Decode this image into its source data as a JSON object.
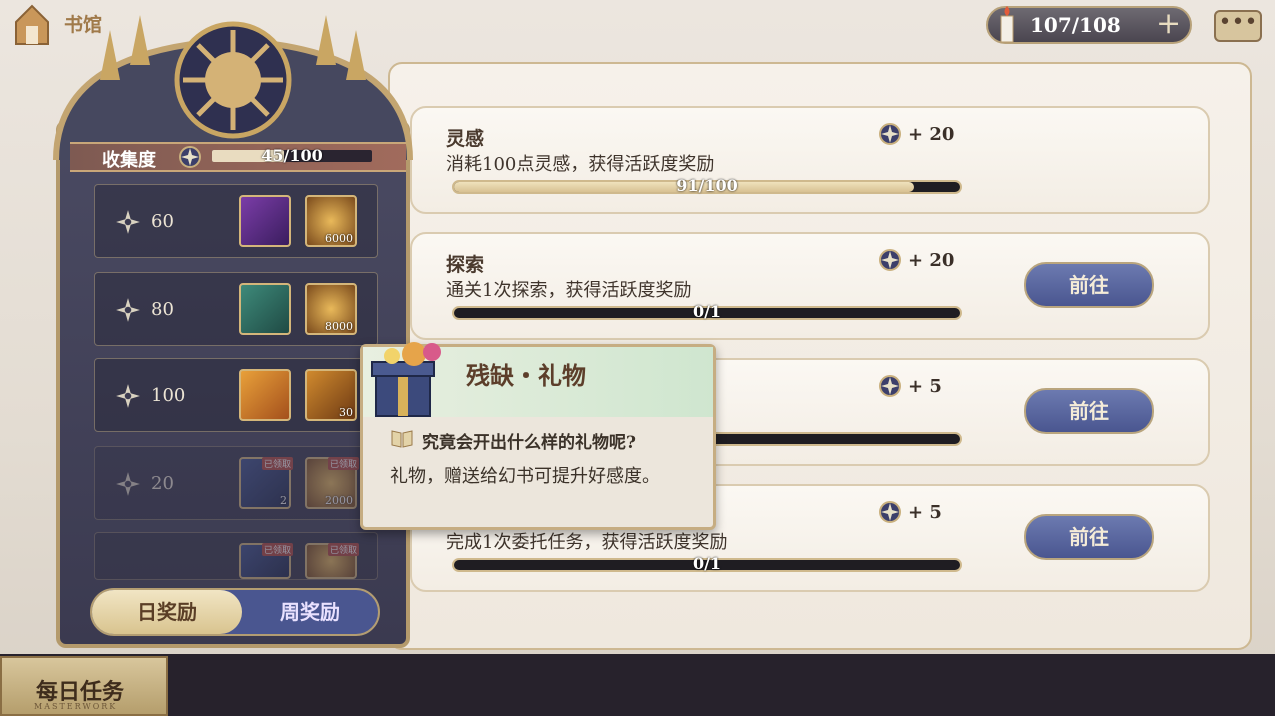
{
  "header": {
    "home_label": "书馆",
    "energy": "107/108",
    "energy_plus": "+",
    "chat_icon": "•••"
  },
  "collection": {
    "label": "收集度",
    "value": "45/100",
    "progress": 0.45
  },
  "rewards": [
    {
      "points": "60",
      "items": [
        {
          "icon": "dice-icon",
          "count": ""
        },
        {
          "icon": "gold-coin-icon",
          "count": "6000"
        }
      ],
      "claimed": false
    },
    {
      "points": "80",
      "items": [
        {
          "icon": "gift-box-icon",
          "count": ""
        },
        {
          "icon": "gold-coin-icon",
          "count": "8000"
        }
      ],
      "claimed": false
    },
    {
      "points": "100",
      "items": [
        {
          "icon": "portrait-frame-icon",
          "count": ""
        },
        {
          "icon": "quill-feather-icon",
          "count": "30"
        }
      ],
      "claimed": false
    },
    {
      "points": "20",
      "items": [
        {
          "icon": "key-icon",
          "count": "2"
        },
        {
          "icon": "gold-coin-icon",
          "count": "2000"
        }
      ],
      "claimed": true,
      "claimed_label": "已领取"
    },
    {
      "points": "",
      "items": [
        {
          "icon": "item-icon",
          "count": ""
        },
        {
          "icon": "item-icon",
          "count": ""
        }
      ],
      "claimed": true,
      "claimed_label": "已领取"
    }
  ],
  "tabs": {
    "day": "日奖励",
    "week": "周奖励"
  },
  "tasks": [
    {
      "title": "灵感",
      "desc": "消耗100点灵感，获得活跃度奖励",
      "reward": "+ 20",
      "progress_text": "91/100",
      "progress": 0.91,
      "button": ""
    },
    {
      "title": "探索",
      "desc": "通关1次探索，获得活跃度奖励",
      "reward": "+ 20",
      "progress_text": "0/1",
      "progress": 0,
      "button": "前往"
    },
    {
      "title": "",
      "desc": "",
      "reward": "+ 5",
      "progress_text": "",
      "progress": 0,
      "button": "前往"
    },
    {
      "title": "",
      "desc": "完成1次委托任务，获得活跃度奖励",
      "reward": "+ 5",
      "progress_text": "0/1",
      "progress": 0,
      "button": "前往"
    }
  ],
  "bottom": {
    "label": "每日任务",
    "sub": "MASTERWORK"
  },
  "tooltip": {
    "title": "残缺・礼物",
    "question": "究竟会开出什么样的礼物呢?",
    "desc": "礼物，赠送给幻书可提升好感度。"
  },
  "colors": {
    "accent": "#b49a6c",
    "button": "#4a5690",
    "panel": "#3b3a50"
  }
}
